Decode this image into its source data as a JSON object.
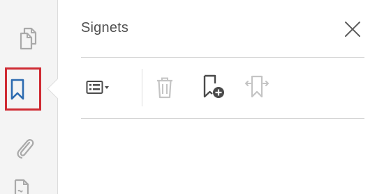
{
  "panel": {
    "title": "Signets"
  },
  "nav": {
    "items": [
      {
        "icon": "pages-icon",
        "active": false
      },
      {
        "icon": "bookmark-icon",
        "active": true
      },
      {
        "icon": "paperclip-icon",
        "active": false
      },
      {
        "icon": "signature-doc-icon",
        "active": false
      }
    ],
    "active_color": "#cf2b33",
    "active_icon_color": "#2d6bb0"
  },
  "toolbar": {
    "tools": [
      {
        "icon": "options-menu-icon",
        "enabled": true
      },
      {
        "icon": "trash-icon",
        "enabled": false
      },
      {
        "icon": "new-bookmark-icon",
        "enabled": true
      },
      {
        "icon": "expand-bookmark-icon",
        "enabled": false
      }
    ]
  },
  "colors": {
    "icon_enabled": "#4a4a4a",
    "icon_disabled": "#c4c4c4",
    "rail_background": "#f4f4f4"
  }
}
